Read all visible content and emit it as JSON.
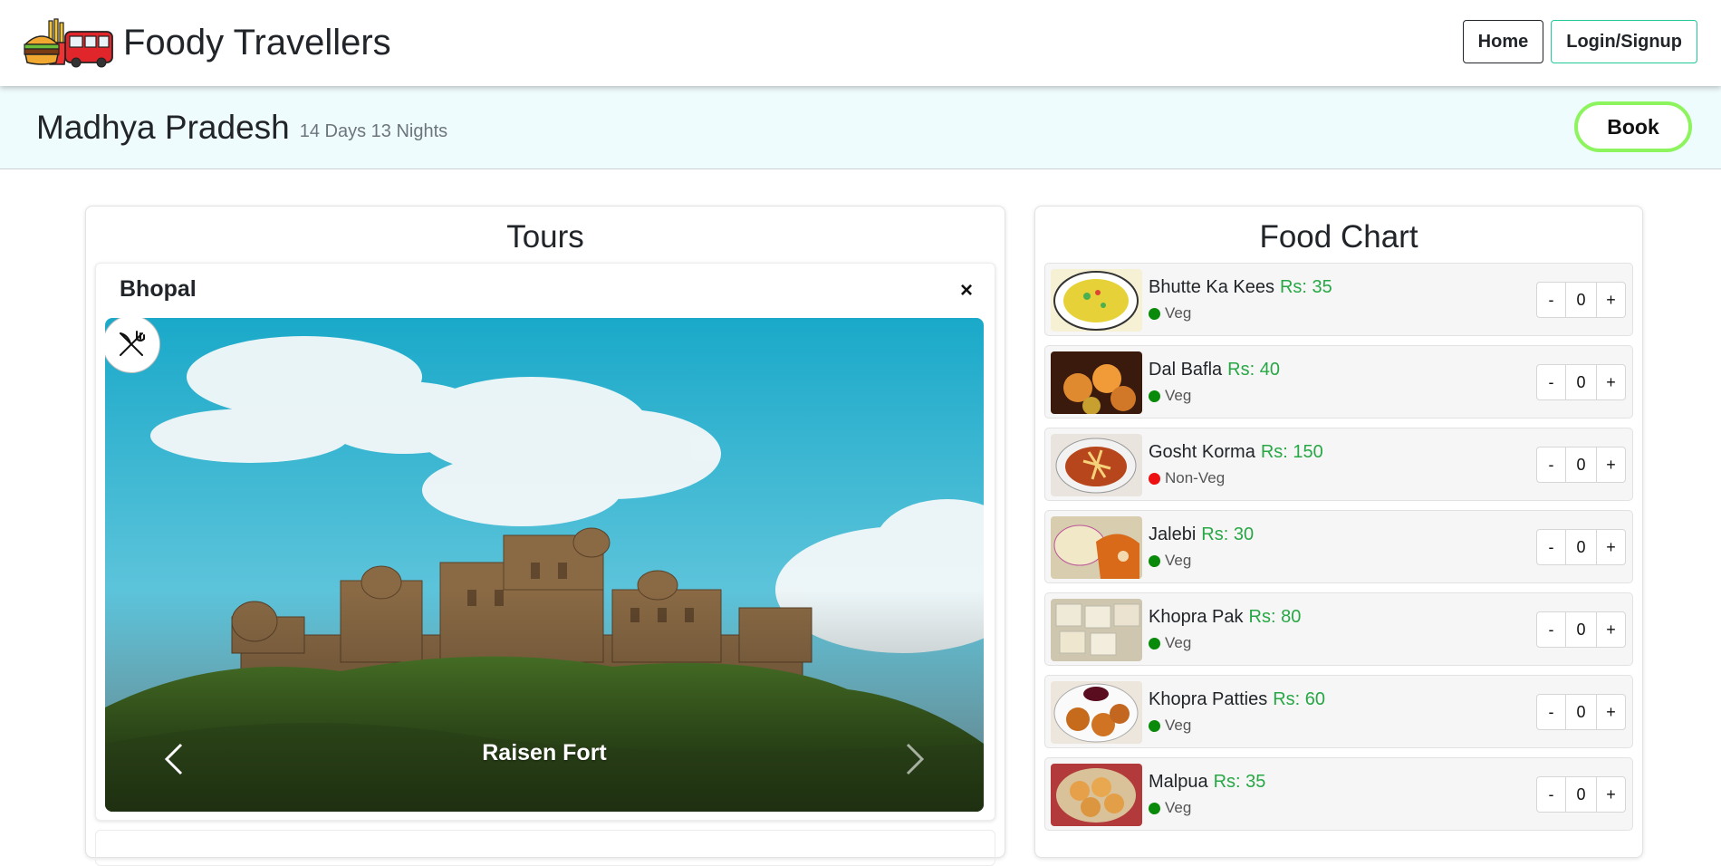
{
  "navbar": {
    "brand": "Foody Travellers",
    "home_label": "Home",
    "login_label": "Login/Signup"
  },
  "trip": {
    "state": "Madhya Pradesh",
    "duration": "14 Days 13 Nights",
    "book_label": "Book"
  },
  "tours": {
    "title": "Tours",
    "city": "Bhopal",
    "close": "×",
    "caption": "Raisen Fort"
  },
  "food_chart": {
    "title": "Food Chart",
    "items": [
      {
        "name": "Bhutte Ka Kees",
        "price": "Rs: 35",
        "type": "Veg",
        "qty": "0"
      },
      {
        "name": "Dal Bafla",
        "price": "Rs: 40",
        "type": "Veg",
        "qty": "0"
      },
      {
        "name": "Gosht Korma",
        "price": "Rs: 150",
        "type": "Non-Veg",
        "qty": "0"
      },
      {
        "name": "Jalebi",
        "price": "Rs: 30",
        "type": "Veg",
        "qty": "0"
      },
      {
        "name": "Khopra Pak",
        "price": "Rs: 80",
        "type": "Veg",
        "qty": "0"
      },
      {
        "name": "Khopra Patties",
        "price": "Rs: 60",
        "type": "Veg",
        "qty": "0"
      },
      {
        "name": "Malpua",
        "price": "Rs: 35",
        "type": "Veg",
        "qty": "0"
      }
    ],
    "minus": "-",
    "plus": "+"
  },
  "colors": {
    "price": "#28a745",
    "veg": "#0a8a0a",
    "nonveg": "#ee1010",
    "book_border": "#8cf45c",
    "subheader_bg": "#effcfd"
  },
  "icons": {
    "brand": "burger-fries-bus-logo",
    "food_badge": "fork-knife-icon",
    "prev": "chevron-left-icon",
    "next": "chevron-right-icon"
  }
}
